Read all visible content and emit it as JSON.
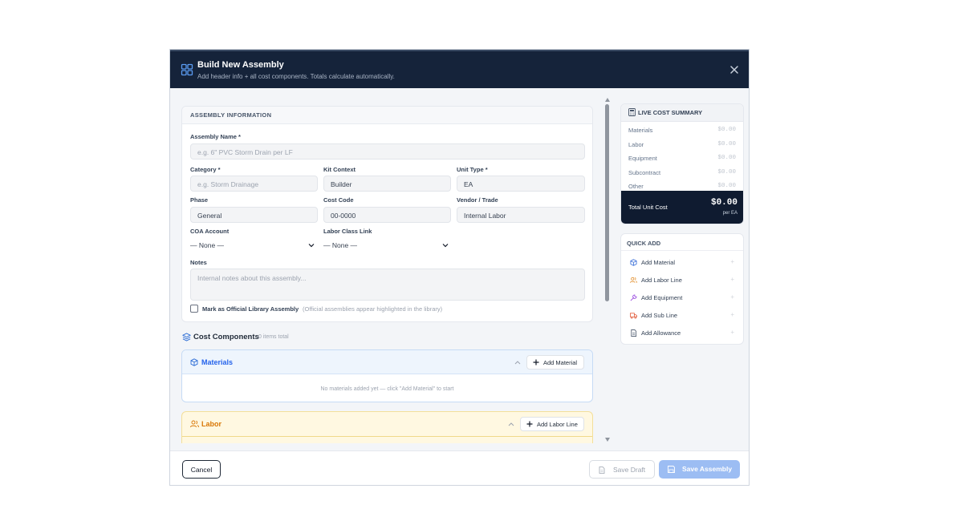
{
  "header": {
    "title": "Build New Assembly",
    "subtitle": "Add header info + all cost components. Totals calculate automatically."
  },
  "assembly_info": {
    "section_title": "ASSEMBLY INFORMATION",
    "name_label": "Assembly Name *",
    "name_placeholder": "e.g. 6\" PVC Storm Drain per LF",
    "category_label": "Category *",
    "category_placeholder": "e.g. Storm Drainage",
    "kit_context_label": "Kit Context",
    "kit_context_value": "Builder",
    "unit_type_label": "Unit Type *",
    "unit_type_value": "EA",
    "phase_label": "Phase",
    "phase_value": "General",
    "cost_code_label": "Cost Code",
    "cost_code_value": "00-0000",
    "vendor_label": "Vendor / Trade",
    "vendor_value": "Internal Labor",
    "coa_label": "COA Account",
    "coa_value": "— None —",
    "labor_class_label": "Labor Class Link",
    "labor_class_value": "— None —",
    "notes_label": "Notes",
    "notes_placeholder": "Internal notes about this assembly...",
    "official_label": "Mark as Official Library Assembly",
    "official_hint": "(Official assemblies appear highlighted in the library)"
  },
  "cost_components": {
    "title": "Cost Components",
    "count": "0 items total",
    "materials": {
      "title": "Materials",
      "add_label": "Add Material",
      "empty_text": "No materials added yet — click \"Add Material\" to start"
    },
    "labor": {
      "title": "Labor",
      "add_label": "Add Labor Line"
    }
  },
  "summary": {
    "title": "LIVE COST SUMMARY",
    "rows": [
      {
        "label": "Materials",
        "value": "$0.00"
      },
      {
        "label": "Labor",
        "value": "$0.00"
      },
      {
        "label": "Equipment",
        "value": "$0.00"
      },
      {
        "label": "Subcontract",
        "value": "$0.00"
      },
      {
        "label": "Other",
        "value": "$0.00"
      }
    ],
    "total_label": "Total Unit Cost",
    "total_value": "$0.00",
    "total_unit": "per EA"
  },
  "quick_add": {
    "title": "QUICK ADD",
    "items": [
      {
        "label": "Add Material",
        "icon": "cube-icon",
        "color": "#3b6fd8"
      },
      {
        "label": "Add Labor Line",
        "icon": "users-icon",
        "color": "#e0861a"
      },
      {
        "label": "Add Equipment",
        "icon": "wrench-icon",
        "color": "#9b4de0"
      },
      {
        "label": "Add Sub Line",
        "icon": "truck-icon",
        "color": "#e25b3a"
      },
      {
        "label": "Add Allowance",
        "icon": "document-icon",
        "color": "#475569"
      }
    ]
  },
  "footer": {
    "cancel_label": "Cancel",
    "draft_label": "Save Draft",
    "save_label": "Save Assembly"
  },
  "colors": {
    "header_bg": "#15233a",
    "accent_blue": "#2f6fd6",
    "labor_orange": "#d97706",
    "save_button": "#9cbdf3"
  }
}
